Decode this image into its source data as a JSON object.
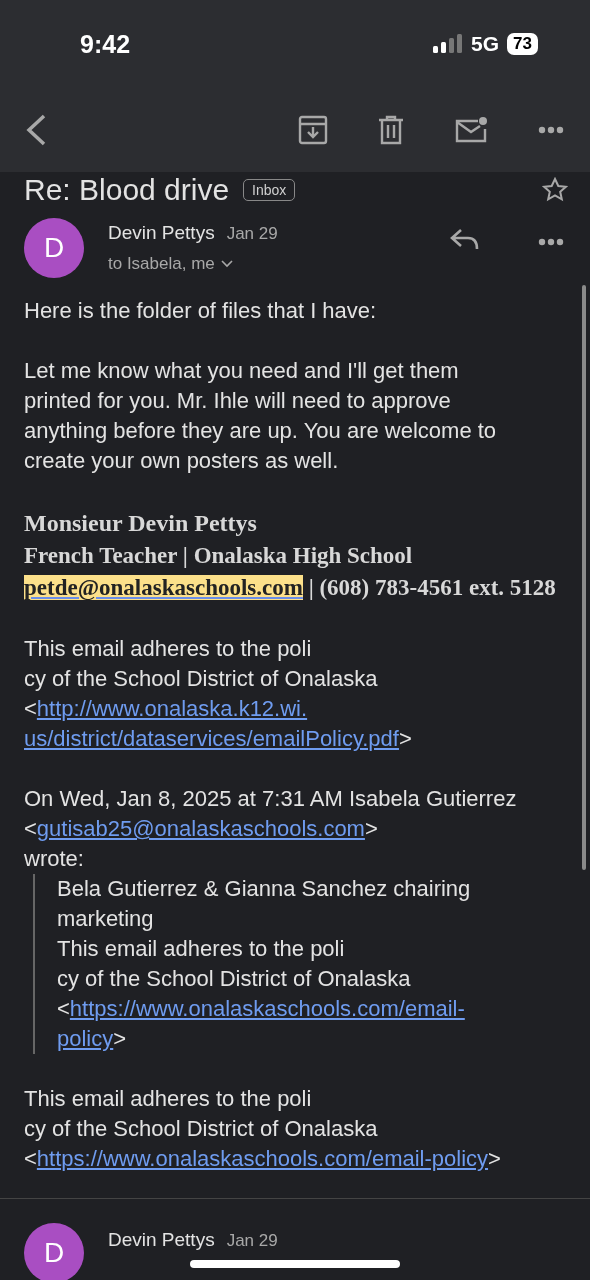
{
  "status_bar": {
    "time": "9:42",
    "network": "5G",
    "battery": "73"
  },
  "subject": {
    "title": "Re: Blood drive",
    "label": "Inbox",
    "starred": false
  },
  "message": {
    "avatar": "D",
    "sender": "Devin Pettys",
    "date": "Jan 29",
    "recipients": "to Isabela, me"
  },
  "body": [
    {
      "kind": "para",
      "lines": [
        "Here is the folder of files that I have:"
      ]
    },
    {
      "kind": "para",
      "lines": [
        "Let me know what you need and I'll get them",
        "printed for you. Mr. Ihle will need to approve",
        "anything before they are up. You are welcome to",
        "create your own posters as well."
      ]
    },
    {
      "kind": "signature",
      "name": "Monsieur Devin Pettys",
      "title": "French Teacher | Onalaska High School",
      "email": "petde@onalaskaschools.com",
      "phone": "| (608) 783-4561 ext. 5128"
    },
    {
      "kind": "policy",
      "lines": [
        "This email adheres to the poli",
        "cy of the School District of Onalaska"
      ],
      "open": "<",
      "close": ">",
      "link_lines": [
        "http://www.onalaska.k12.wi.",
        "us/district/dataservices/emailPolicy.pdf"
      ]
    },
    {
      "kind": "intro",
      "before": "On Wed, Jan 8, 2025 at 7:31 AM Isabela Gutierrez <",
      "email": "gutisab25@onalaskaschools.com",
      "after": ">",
      "wrote": "wrote:"
    },
    {
      "kind": "quote",
      "lines": [
        "Bela Gutierrez & Gianna Sanchez chairing",
        "marketing"
      ],
      "policy": {
        "lines": [
          "This email adheres to the poli",
          "cy of the School District of Onalaska"
        ],
        "open": "<",
        "close": ">",
        "link_lines": [
          "https://www.onalaskaschools.com/email-",
          "policy"
        ]
      }
    },
    {
      "kind": "policy",
      "lines": [
        "This email adheres to the poli",
        "cy of the School District of Onalaska"
      ],
      "open": "<",
      "close": ">",
      "link_lines": [
        "https://www.onalaskaschools.com/email-policy"
      ]
    }
  ],
  "next_message": {
    "avatar": "D",
    "sender": "Devin Pettys",
    "date": "Jan 29"
  }
}
